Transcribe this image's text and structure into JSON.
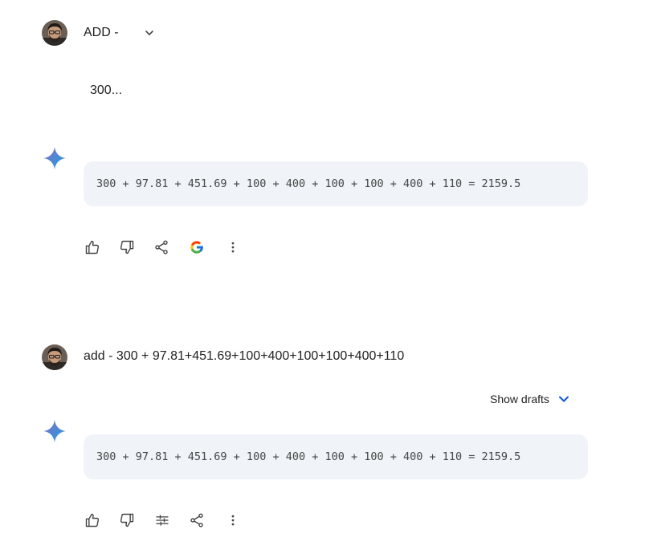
{
  "conversation": {
    "turn1": {
      "user_prompt": "ADD -",
      "user_continuation": "300...",
      "response_code": "300 + 97.81 + 451.69 + 100 + 400 + 100 + 100 + 400 + 110 = 2159.5"
    },
    "turn2": {
      "user_prompt": "add - 300 + 97.81+451.69+100+400+100+100+400+110",
      "show_drafts_label": "Show drafts",
      "response_code": "300 + 97.81 + 451.69 + 100 + 400 + 100 + 100 + 400 + 110 = 2159.5"
    }
  },
  "icons": {
    "avatar": "user-avatar",
    "gemini": "gemini-sparkle-icon",
    "turn1_actions": [
      "thumbs-up-icon",
      "thumbs-down-icon",
      "share-icon",
      "google-icon",
      "more-vert-icon"
    ],
    "turn2_actions": [
      "thumbs-up-icon",
      "thumbs-down-icon",
      "tune-icon",
      "share-icon",
      "more-vert-icon"
    ]
  },
  "colors": {
    "code_background": "#f0f4f9",
    "accent_blue": "#0b57d0",
    "icon_gray": "#444746"
  }
}
